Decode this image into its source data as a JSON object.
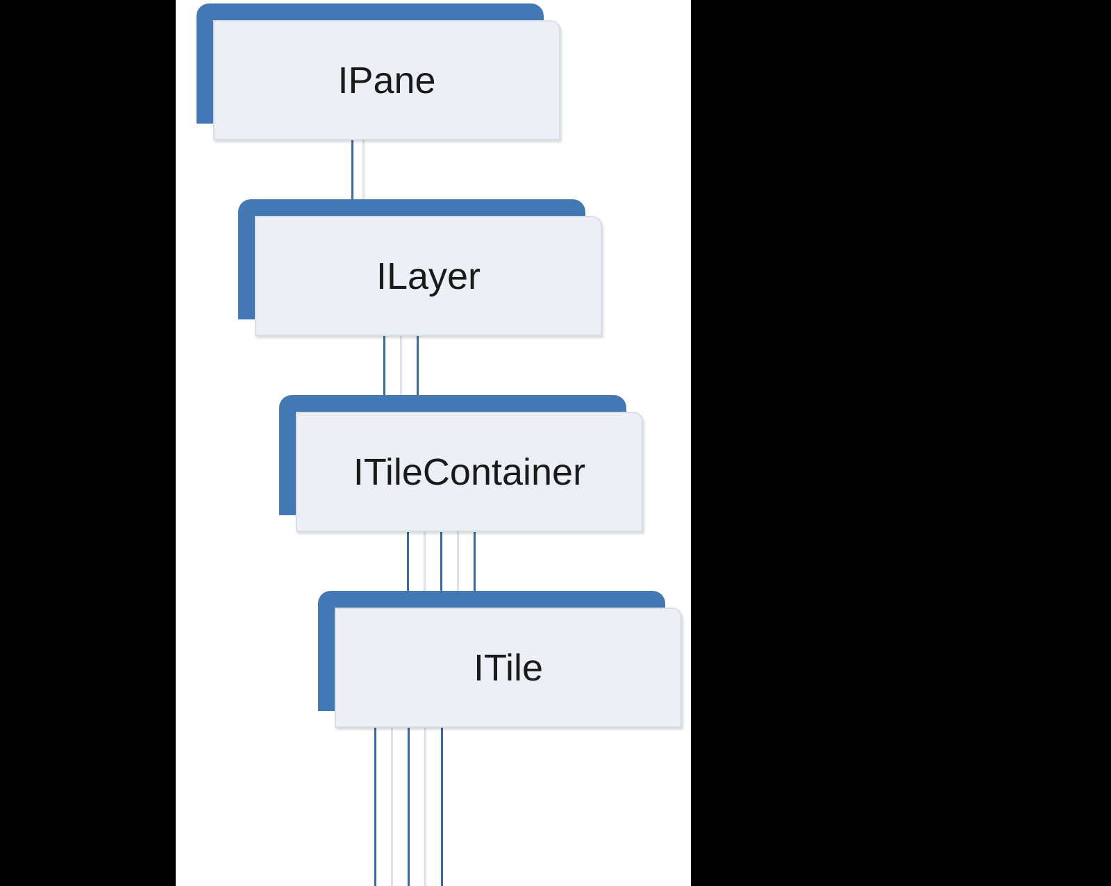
{
  "diagram": {
    "nodes": [
      {
        "id": "ipane",
        "label": "IPane"
      },
      {
        "id": "ilayer",
        "label": "ILayer"
      },
      {
        "id": "itilecontainer",
        "label": "ITileContainer"
      },
      {
        "id": "itile",
        "label": "ITile"
      }
    ],
    "colors": {
      "accent": "#4478b4",
      "panel": "#ecf0f6",
      "page": "#ffffff",
      "frame": "#000000"
    }
  }
}
